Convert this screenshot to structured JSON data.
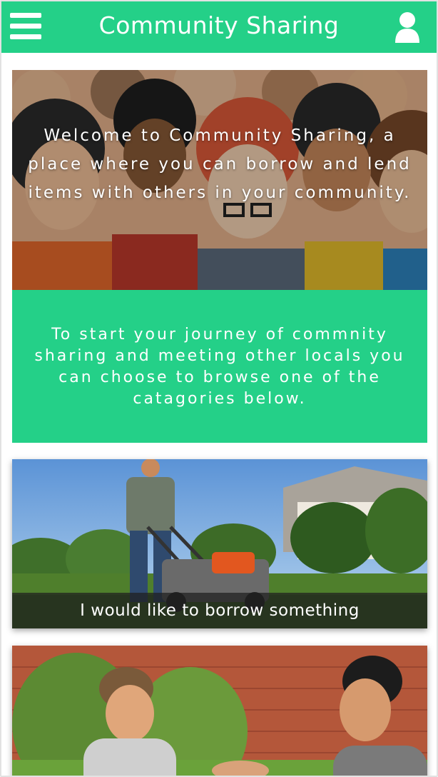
{
  "header": {
    "title": "Community Sharing",
    "menu_icon": "hamburger-menu-icon",
    "user_icon": "user-icon",
    "color": "#24d088"
  },
  "hero": {
    "text": "Welcome to Community Sharing, a place where you can borrow and lend items with others in your community."
  },
  "info": {
    "text": "To start your journey of commnity sharing and meeting other locals you can choose to browse one of the catagories below."
  },
  "cards": [
    {
      "caption": "I would like to borrow something"
    },
    {
      "caption": ""
    }
  ]
}
